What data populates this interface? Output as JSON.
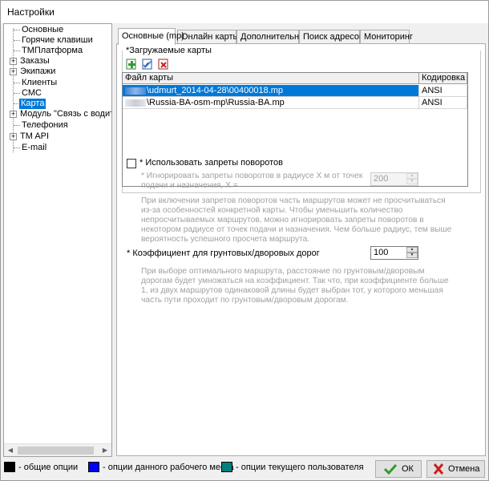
{
  "window": {
    "title": "Настройки"
  },
  "tree": {
    "items": [
      {
        "label": "Основные",
        "expandable": false
      },
      {
        "label": "Горячие клавиши",
        "expandable": false
      },
      {
        "label": "ТМПлатформа",
        "expandable": false
      },
      {
        "label": "Заказы",
        "expandable": true
      },
      {
        "label": "Экипажи",
        "expandable": true
      },
      {
        "label": "Клиенты",
        "expandable": false
      },
      {
        "label": "СМС",
        "expandable": false
      },
      {
        "label": "Карта",
        "expandable": false,
        "selected": true
      },
      {
        "label": "Модуль \"Связь с водителем\"",
        "expandable": true
      },
      {
        "label": "Телефония",
        "expandable": false
      },
      {
        "label": "TM API",
        "expandable": true
      },
      {
        "label": "E-mail",
        "expandable": false
      }
    ]
  },
  "tabs": [
    {
      "label": "Основные (mp)",
      "active": true
    },
    {
      "label": "Онлайн карты"
    },
    {
      "label": "Дополнительно"
    },
    {
      "label": "Поиск адресов"
    },
    {
      "label": "Мониторинг"
    }
  ],
  "maps_group": {
    "label": "*Загружаемые карты",
    "toolbar": {
      "add_icon": "add-map-icon",
      "edit_icon": "edit-map-icon",
      "delete_icon": "delete-map-icon"
    },
    "columns": [
      "Файл карты",
      "Кодировка"
    ],
    "rows": [
      {
        "file": "\\udmurt_2014-04-28\\00400018.mp",
        "encoding": "ANSI",
        "selected": true
      },
      {
        "file": "\\Russia-BA-osm-mp\\Russia-BA.mp",
        "encoding": "ANSI",
        "selected": false
      }
    ]
  },
  "turns": {
    "checkbox_label": "* Использовать запреты поворотов",
    "checked": false,
    "radius_label_line1": "* Игнорировать запреты поворотов в радиусе X м от точек",
    "radius_label_line2": "подачи  и назначения, X =",
    "radius_value": "200",
    "description": [
      "При включении запретов поворотов часть маршрутов может не просчитываться",
      "из-за особенностей конкретной карты. Чтобы уменьшить количество",
      "непросчитываемых маршрутов, можно игнорировать запреты поворотов в",
      "некотором радиусе от точек подачи и назначения. Чем больше радиус, тем выше",
      "вероятность успешного просчета маршрута."
    ]
  },
  "dirt_roads": {
    "label": "* Коэффициент для грунтовых/дворовых дорог",
    "value": "100",
    "description": [
      "При выборе оптимального маршрута, расстояние по грунтовым/дворовым",
      "дорогам будет умножаться на коэффициент. Так что, при коэффициенте больше",
      "1, из двух маршрутов одинаковой длины будет выбран тот, у которого меньшая",
      "часть пути проходит по грунтовым/дворовым дорогам."
    ]
  },
  "legend": [
    {
      "label": "- общие опции",
      "color": "#000000"
    },
    {
      "label": "- опции данного рабочего места",
      "color": "#0000ff"
    },
    {
      "label": "- опции текущего пользователя",
      "color": "#008080"
    }
  ],
  "buttons": {
    "ok_label": "ОК",
    "ok_icon": "checkmark-icon",
    "cancel_label": "Отмена",
    "cancel_icon": "cross-icon",
    "colors": {
      "ok_icon": "#2e9e2e",
      "cancel_icon": "#cc1e1e"
    }
  }
}
